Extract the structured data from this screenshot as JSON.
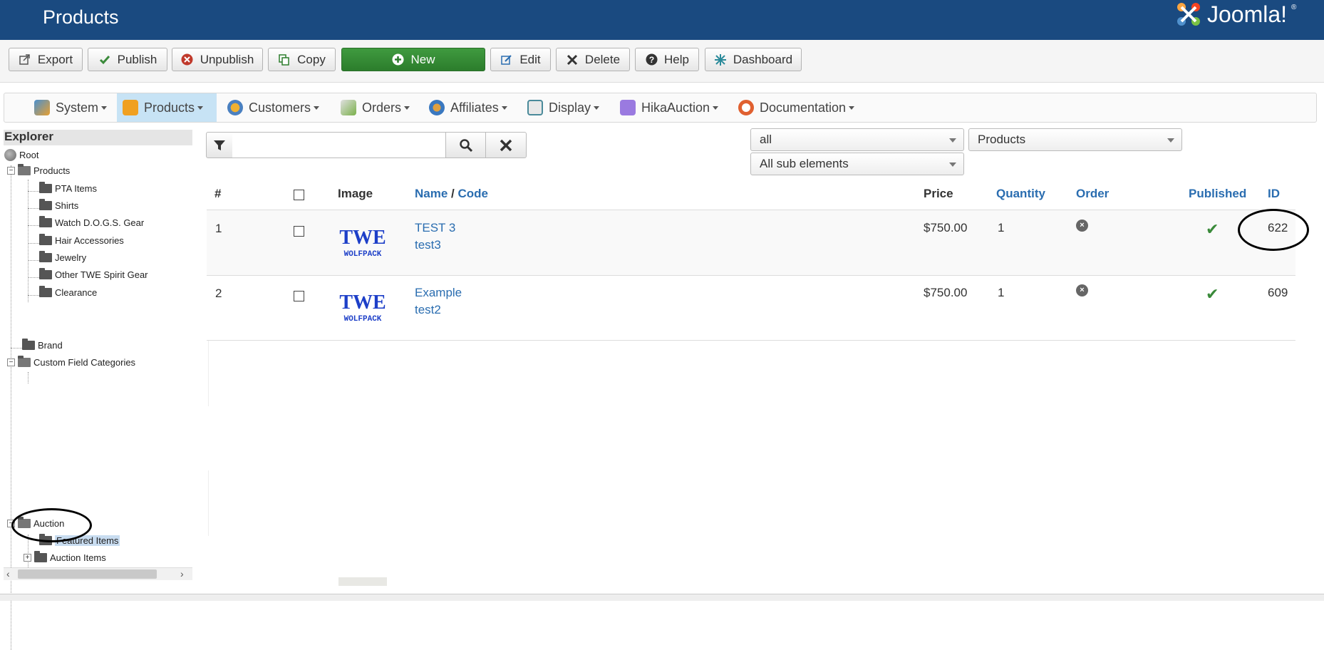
{
  "header": {
    "title": "Products",
    "logo_text": "Joomla!",
    "logo_reg": "®"
  },
  "toolbar": {
    "export": "Export",
    "publish": "Publish",
    "unpublish": "Unpublish",
    "copy": "Copy",
    "new": "New",
    "edit": "Edit",
    "delete": "Delete",
    "help": "Help",
    "dashboard": "Dashboard"
  },
  "menu": {
    "system": "System",
    "products": "Products",
    "customers": "Customers",
    "orders": "Orders",
    "affiliates": "Affiliates",
    "display": "Display",
    "hikaauction": "HikaAuction",
    "documentation": "Documentation"
  },
  "explorer": {
    "title": "Explorer",
    "root": "Root",
    "products": "Products",
    "product_children": [
      "PTA Items",
      "Shirts",
      "Watch D.O.G.S. Gear",
      "Hair Accessories",
      "Jewelry",
      "Other TWE Spirit Gear",
      "Clearance"
    ],
    "brand": "Brand",
    "custom_field_categories": "Custom Field Categories",
    "auction": "Auction",
    "auction_children": [
      "Featured Items",
      "Auction Items"
    ]
  },
  "filters": {
    "search_value": "",
    "status_select": "all",
    "type_select": "Products",
    "sub_select": "All sub elements"
  },
  "table": {
    "headers": {
      "num": "#",
      "image": "Image",
      "name": "Name",
      "slash": "/",
      "code": "Code",
      "price": "Price",
      "quantity": "Quantity",
      "order": "Order",
      "published": "Published",
      "id": "ID"
    },
    "rows": [
      {
        "num": "1",
        "logo_top": "TWE",
        "logo_bottom": "WOLFPACK",
        "name": "TEST 3",
        "code": "test3",
        "price": "$750.00",
        "quantity": "1",
        "id": "622"
      },
      {
        "num": "2",
        "logo_top": "TWE",
        "logo_bottom": "WOLFPACK",
        "name": "Example",
        "code": "test2",
        "price": "$750.00",
        "quantity": "1",
        "id": "609"
      }
    ]
  },
  "colors": {
    "header_bg": "#1a4a80",
    "link": "#2a6db0",
    "new_button": "#3a923a",
    "published_check": "#3a8a3a",
    "active_menu": "#c7e3f5"
  }
}
